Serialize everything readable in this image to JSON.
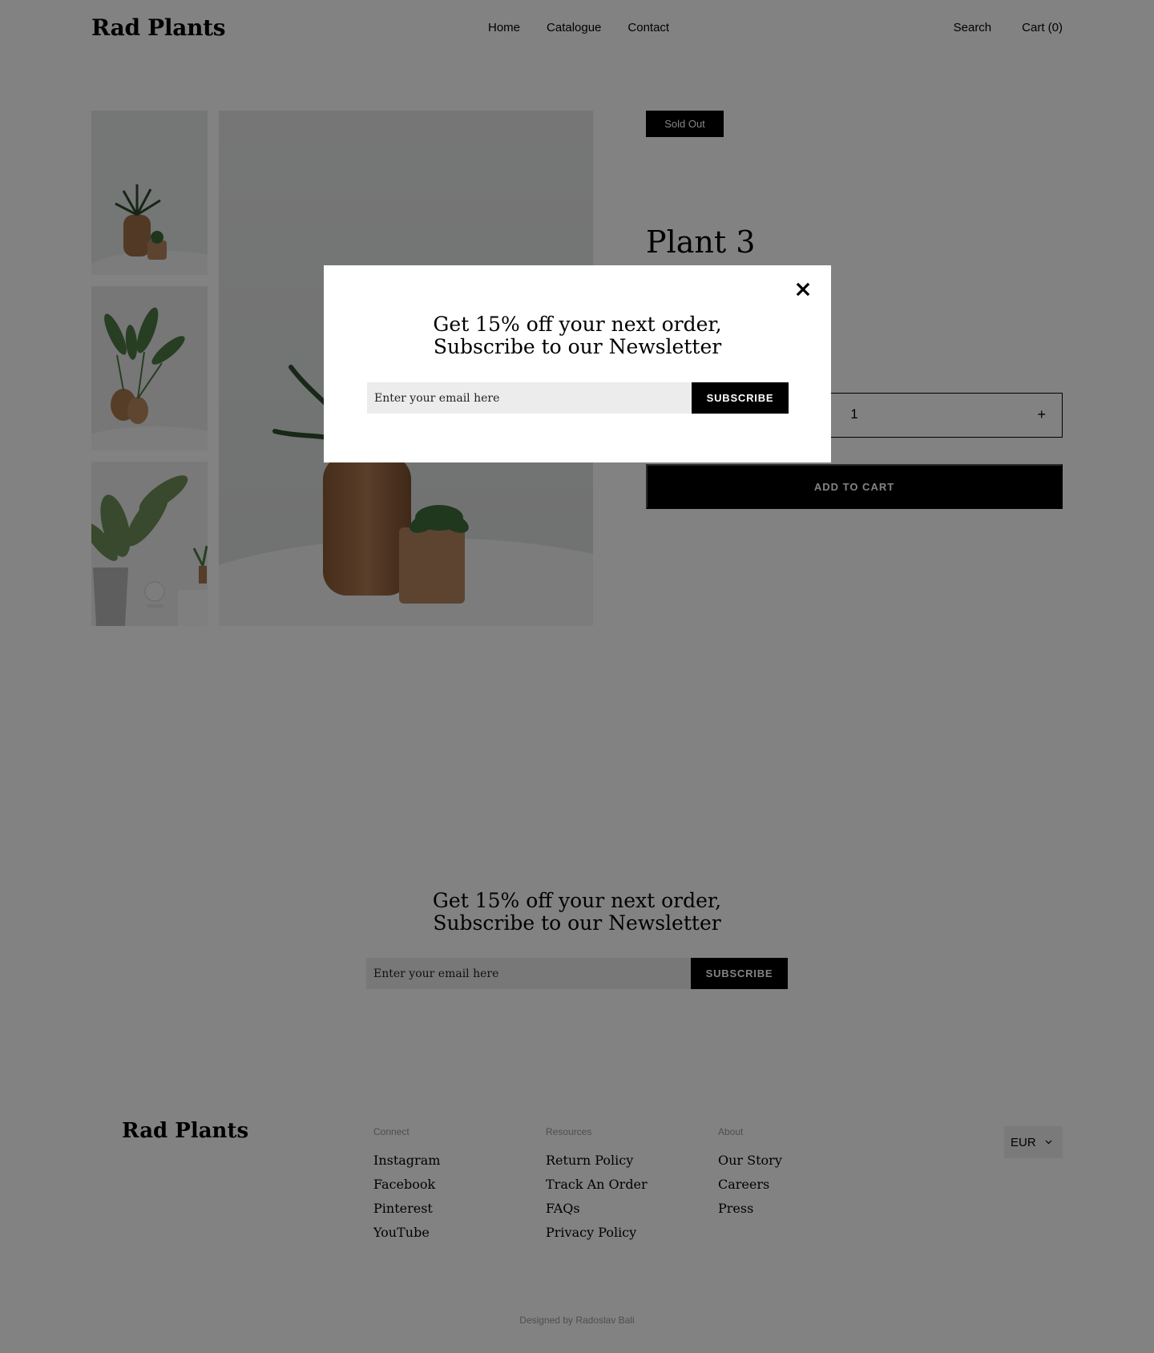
{
  "header": {
    "logo": "Rad Plants",
    "nav": [
      "Home",
      "Catalogue",
      "Contact"
    ],
    "search_label": "Search",
    "cart_label": "Cart (0)"
  },
  "product": {
    "badge": "Sold Out",
    "title": "Plant 3",
    "quantity": "1",
    "minus_label": "−",
    "plus_label": "+",
    "add_to_cart_label": "ADD TO CART"
  },
  "newsletter": {
    "heading_line1": "Get 15% off your next order,",
    "heading_line2": "Subscribe to our Newsletter",
    "email_placeholder": "Enter your email here",
    "button_label": "SUBSCRIBE"
  },
  "modal": {
    "heading_line1": "Get 15% off your next order,",
    "heading_line2": "Subscribe to our Newsletter",
    "email_placeholder": "Enter your email here",
    "button_label": "SUBSCRIBE",
    "close_icon": "close-icon"
  },
  "footer": {
    "logo": "Rad Plants",
    "columns": [
      {
        "title": "Connect",
        "links": [
          "Instagram",
          "Facebook",
          "Pinterest",
          "YouTube"
        ]
      },
      {
        "title": "Resources",
        "links": [
          "Return Policy",
          "Track An Order",
          "FAQs",
          "Privacy Policy"
        ]
      },
      {
        "title": "About",
        "links": [
          "Our Story",
          "Careers",
          "Press"
        ]
      }
    ],
    "currency": "EUR",
    "designed_by": "Designed by Radoslav Bali"
  },
  "colors": {
    "overlay": "#000000",
    "accent": "#000000",
    "input_bg": "#ececec"
  }
}
